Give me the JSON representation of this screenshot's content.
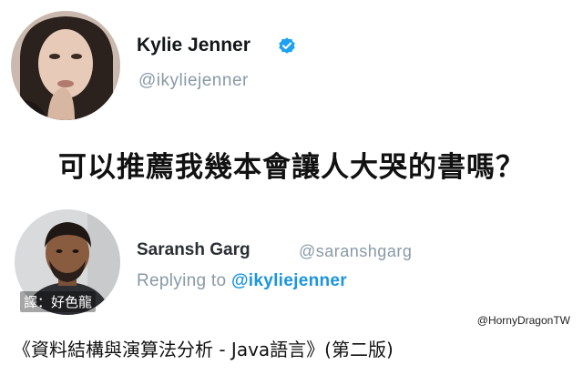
{
  "tweet": {
    "author_name": "Kylie Jenner",
    "author_handle": "@ikyliejenner",
    "verified_icon": "verified-badge-icon",
    "text": "可以推薦我幾本會讓人大哭的書嗎？"
  },
  "reply": {
    "author_name": "Saransh Garg",
    "author_handle": "@saranshgarg",
    "replying_prefix": "Replying to",
    "replying_mention": "@ikyliejenner",
    "translator_credit": "譯：好色龍"
  },
  "watermark": "@HornyDragonTW",
  "answer_text": "《資料結構與演算法分析 - Java語言》(第二版)",
  "colors": {
    "verified_blue": "#1da1f2",
    "handle_gray": "#8899a6",
    "mention_blue": "#1b95e0"
  }
}
